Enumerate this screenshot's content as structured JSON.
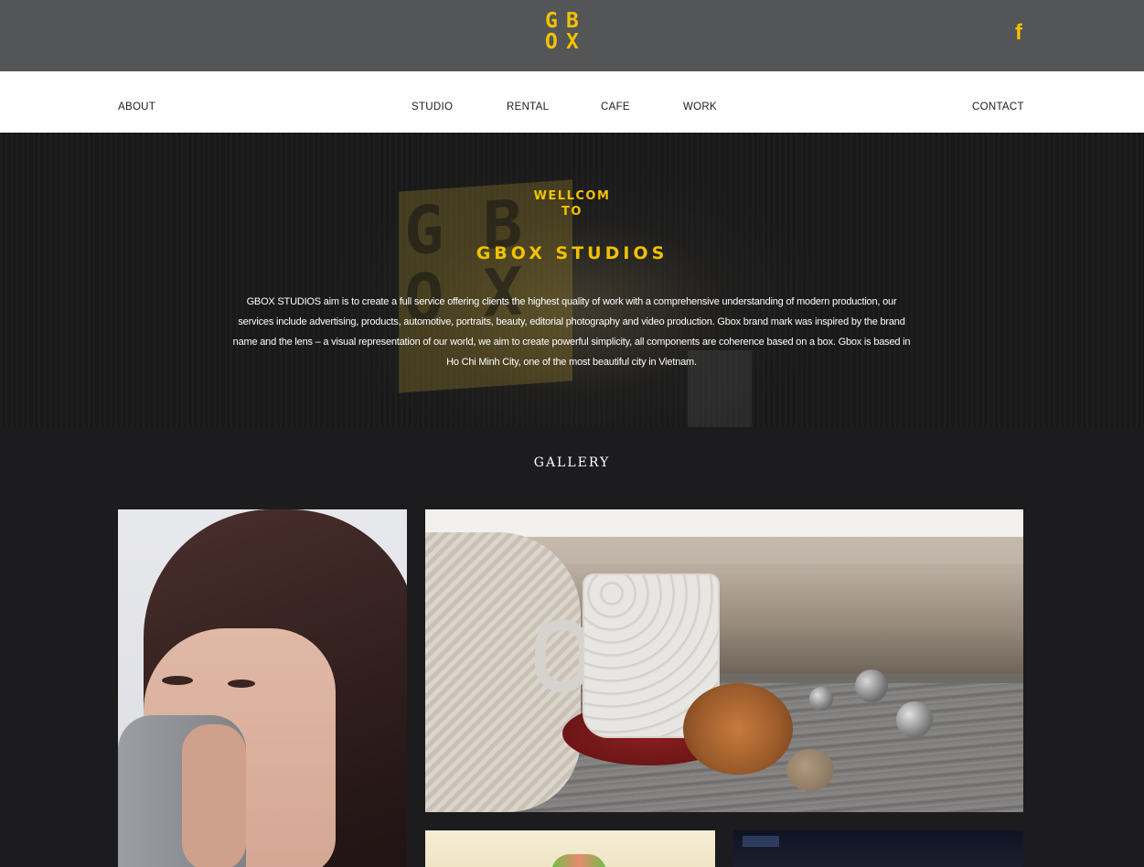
{
  "header": {
    "logo_letters": [
      "G",
      "B",
      "O",
      "X"
    ],
    "social": {
      "icon": "facebook-icon",
      "glyph": "f"
    }
  },
  "nav": {
    "about": "ABOUT",
    "studio": "STUDIO",
    "rental": "RENTAL",
    "cafe": "CAFE",
    "work": "WORK",
    "contact": "CONTACT"
  },
  "hero": {
    "welcome_line1": "WELLCOM",
    "welcome_line2": "TO",
    "brand": "GBOX STUDIOS",
    "intro": "GBOX STUDIOS aim is to create a full service offering clients the highest quality of work with a comprehensive understanding of modern production, our services include advertising, products, automotive, portraits, beauty, editorial photography and video production. Gbox brand mark was inspired by the brand name and the lens – a visual representation of our world, we aim to create powerful simplicity, all components are coherence based on a box. Gbox is based in Ho Chi Minh City, one of the most beautiful city in Vietnam."
  },
  "gallery": {
    "title": "GALLERY"
  },
  "colors": {
    "accent": "#f2c200",
    "topbar": "#545557",
    "dark_bg": "#1c1c1f",
    "nav_bg": "#ffffff"
  }
}
